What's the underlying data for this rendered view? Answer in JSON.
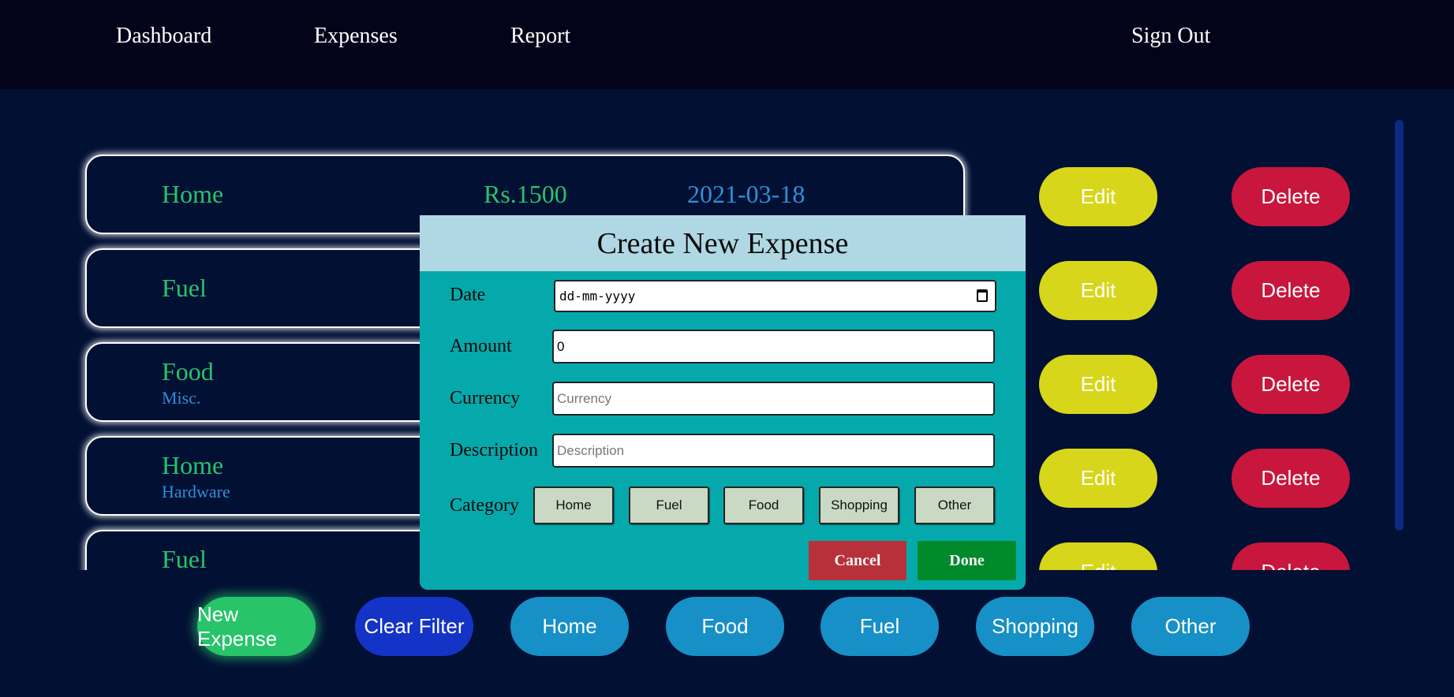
{
  "nav": {
    "dashboard": "Dashboard",
    "expenses": "Expenses",
    "report": "Report",
    "signout": "Sign Out"
  },
  "expenses": [
    {
      "category": "Home",
      "subcategory": "",
      "amount": "Rs.1500",
      "date": "2021-03-18"
    },
    {
      "category": "Fuel",
      "subcategory": "",
      "amount": "",
      "date": ""
    },
    {
      "category": "Food",
      "subcategory": "Misc.",
      "amount": "",
      "date": ""
    },
    {
      "category": "Home",
      "subcategory": "Hardware",
      "amount": "",
      "date": ""
    },
    {
      "category": "Fuel",
      "subcategory": "",
      "amount": "",
      "date": ""
    }
  ],
  "row_actions": {
    "edit": "Edit",
    "delete": "Delete"
  },
  "bottom": {
    "new_expense": "New Expense",
    "clear_filter": "Clear Filter",
    "filters": [
      "Home",
      "Food",
      "Fuel",
      "Shopping",
      "Other"
    ]
  },
  "modal": {
    "title": "Create New Expense",
    "date_label": "Date",
    "date_value": "dd-mm-yyyy",
    "amount_label": "Amount",
    "amount_value": "0",
    "currency_label": "Currency",
    "currency_placeholder": "Currency",
    "description_label": "Description",
    "description_placeholder": "Description",
    "category_label": "Category",
    "categories": [
      "Home",
      "Fuel",
      "Food",
      "Shopping",
      "Other"
    ],
    "cancel": "Cancel",
    "done": "Done"
  },
  "colors": {
    "background": "#021034",
    "navbar": "#03031a",
    "category_text": "#27c46a",
    "date_text": "#2f8fd6",
    "edit": "#d8d61a",
    "delete": "#c8163c",
    "new_expense": "#27c46a",
    "clear_filter": "#1433c7",
    "filter": "#1690c6",
    "modal_body": "#06a9ab",
    "modal_header": "#afd8e4",
    "cancel": "#b7313a",
    "done": "#008a2c"
  }
}
